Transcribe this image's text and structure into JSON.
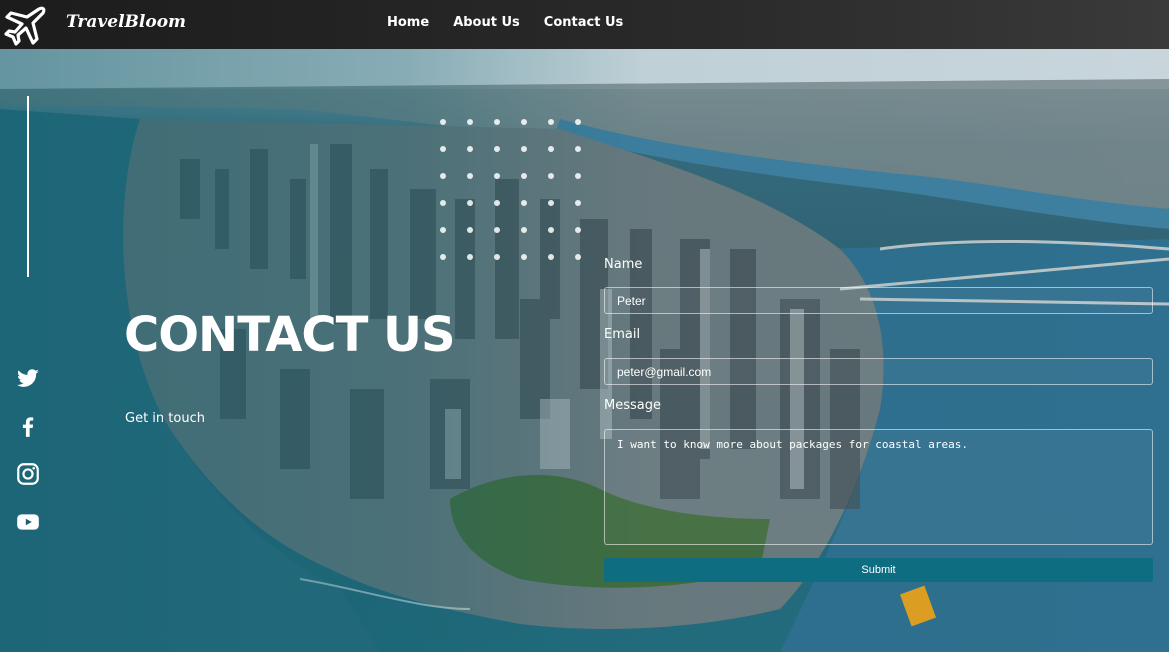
{
  "header": {
    "brand": "TravelBloom",
    "nav": [
      "Home",
      "About Us",
      "Contact Us"
    ]
  },
  "hero": {
    "title": "CONTACT US",
    "subtitle": "Get in touch"
  },
  "social": [
    "twitter-icon",
    "facebook-icon",
    "instagram-icon",
    "youtube-icon"
  ],
  "form": {
    "name_label": "Name",
    "name_value": "Peter",
    "email_label": "Email",
    "email_value": "peter@gmail.com",
    "message_label": "Message",
    "message_value": "I want to know more about packages for coastal areas.",
    "submit_label": "Submit"
  },
  "colors": {
    "header_bg": "#1c1c1c",
    "accent": "#0f6d82",
    "text": "#ffffff"
  }
}
